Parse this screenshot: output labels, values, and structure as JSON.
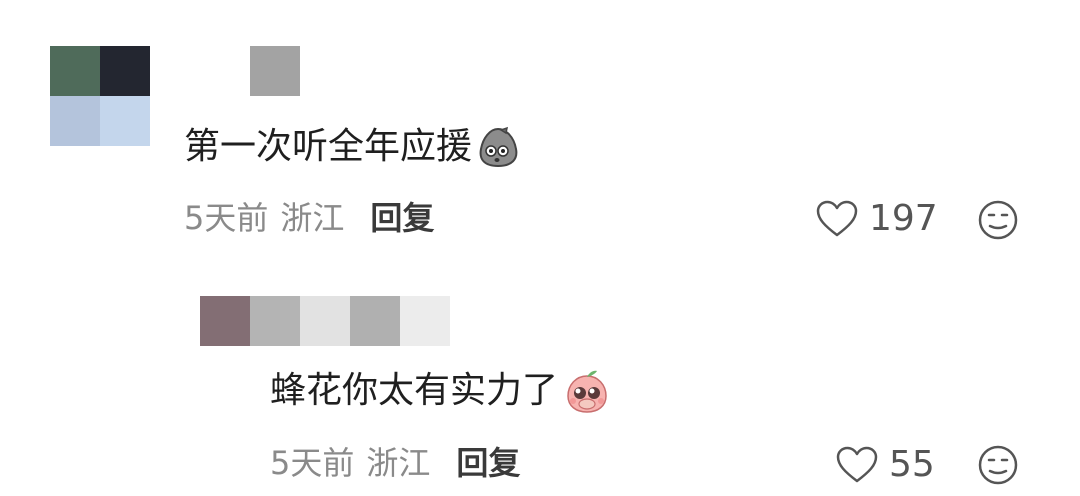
{
  "comments": [
    {
      "text": "第一次听全年应援",
      "emoji": "potato-face-emoji",
      "time": "5天前",
      "location": "浙江",
      "reply_label": "回复",
      "likes": "197"
    },
    {
      "text": "蜂花你太有实力了",
      "emoji": "peach-face-emoji",
      "time": "5天前",
      "location": "浙江",
      "reply_label": "回复",
      "likes": "55"
    }
  ],
  "colors": {
    "text": "#1f1f1f",
    "meta": "#8a8a8a",
    "icon": "#555555"
  }
}
